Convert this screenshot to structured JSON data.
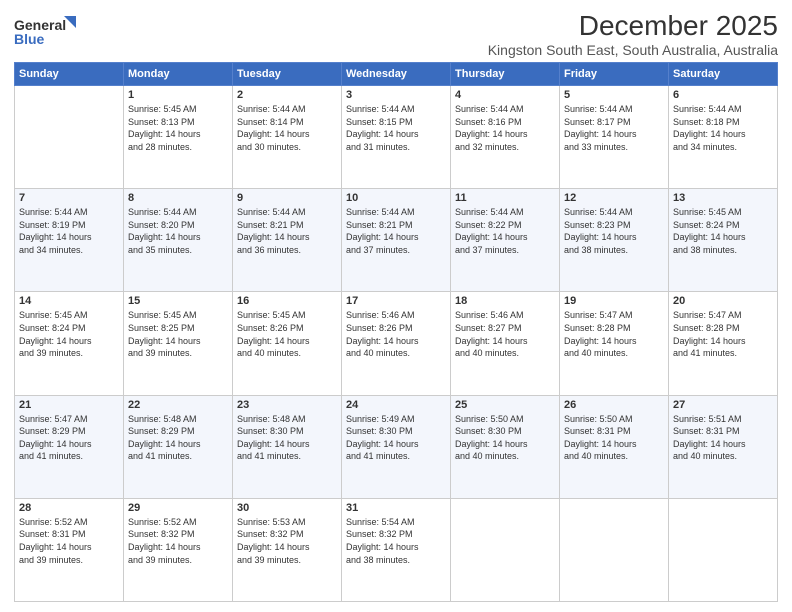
{
  "header": {
    "logo_line1": "General",
    "logo_line2": "Blue",
    "month": "December 2025",
    "location": "Kingston South East, South Australia, Australia"
  },
  "weekdays": [
    "Sunday",
    "Monday",
    "Tuesday",
    "Wednesday",
    "Thursday",
    "Friday",
    "Saturday"
  ],
  "weeks": [
    [
      {
        "day": "",
        "info": ""
      },
      {
        "day": "1",
        "info": "Sunrise: 5:45 AM\nSunset: 8:13 PM\nDaylight: 14 hours\nand 28 minutes."
      },
      {
        "day": "2",
        "info": "Sunrise: 5:44 AM\nSunset: 8:14 PM\nDaylight: 14 hours\nand 30 minutes."
      },
      {
        "day": "3",
        "info": "Sunrise: 5:44 AM\nSunset: 8:15 PM\nDaylight: 14 hours\nand 31 minutes."
      },
      {
        "day": "4",
        "info": "Sunrise: 5:44 AM\nSunset: 8:16 PM\nDaylight: 14 hours\nand 32 minutes."
      },
      {
        "day": "5",
        "info": "Sunrise: 5:44 AM\nSunset: 8:17 PM\nDaylight: 14 hours\nand 33 minutes."
      },
      {
        "day": "6",
        "info": "Sunrise: 5:44 AM\nSunset: 8:18 PM\nDaylight: 14 hours\nand 34 minutes."
      }
    ],
    [
      {
        "day": "7",
        "info": "Sunrise: 5:44 AM\nSunset: 8:19 PM\nDaylight: 14 hours\nand 34 minutes."
      },
      {
        "day": "8",
        "info": "Sunrise: 5:44 AM\nSunset: 8:20 PM\nDaylight: 14 hours\nand 35 minutes."
      },
      {
        "day": "9",
        "info": "Sunrise: 5:44 AM\nSunset: 8:21 PM\nDaylight: 14 hours\nand 36 minutes."
      },
      {
        "day": "10",
        "info": "Sunrise: 5:44 AM\nSunset: 8:21 PM\nDaylight: 14 hours\nand 37 minutes."
      },
      {
        "day": "11",
        "info": "Sunrise: 5:44 AM\nSunset: 8:22 PM\nDaylight: 14 hours\nand 37 minutes."
      },
      {
        "day": "12",
        "info": "Sunrise: 5:44 AM\nSunset: 8:23 PM\nDaylight: 14 hours\nand 38 minutes."
      },
      {
        "day": "13",
        "info": "Sunrise: 5:45 AM\nSunset: 8:24 PM\nDaylight: 14 hours\nand 38 minutes."
      }
    ],
    [
      {
        "day": "14",
        "info": "Sunrise: 5:45 AM\nSunset: 8:24 PM\nDaylight: 14 hours\nand 39 minutes."
      },
      {
        "day": "15",
        "info": "Sunrise: 5:45 AM\nSunset: 8:25 PM\nDaylight: 14 hours\nand 39 minutes."
      },
      {
        "day": "16",
        "info": "Sunrise: 5:45 AM\nSunset: 8:26 PM\nDaylight: 14 hours\nand 40 minutes."
      },
      {
        "day": "17",
        "info": "Sunrise: 5:46 AM\nSunset: 8:26 PM\nDaylight: 14 hours\nand 40 minutes."
      },
      {
        "day": "18",
        "info": "Sunrise: 5:46 AM\nSunset: 8:27 PM\nDaylight: 14 hours\nand 40 minutes."
      },
      {
        "day": "19",
        "info": "Sunrise: 5:47 AM\nSunset: 8:28 PM\nDaylight: 14 hours\nand 40 minutes."
      },
      {
        "day": "20",
        "info": "Sunrise: 5:47 AM\nSunset: 8:28 PM\nDaylight: 14 hours\nand 41 minutes."
      }
    ],
    [
      {
        "day": "21",
        "info": "Sunrise: 5:47 AM\nSunset: 8:29 PM\nDaylight: 14 hours\nand 41 minutes."
      },
      {
        "day": "22",
        "info": "Sunrise: 5:48 AM\nSunset: 8:29 PM\nDaylight: 14 hours\nand 41 minutes."
      },
      {
        "day": "23",
        "info": "Sunrise: 5:48 AM\nSunset: 8:30 PM\nDaylight: 14 hours\nand 41 minutes."
      },
      {
        "day": "24",
        "info": "Sunrise: 5:49 AM\nSunset: 8:30 PM\nDaylight: 14 hours\nand 41 minutes."
      },
      {
        "day": "25",
        "info": "Sunrise: 5:50 AM\nSunset: 8:30 PM\nDaylight: 14 hours\nand 40 minutes."
      },
      {
        "day": "26",
        "info": "Sunrise: 5:50 AM\nSunset: 8:31 PM\nDaylight: 14 hours\nand 40 minutes."
      },
      {
        "day": "27",
        "info": "Sunrise: 5:51 AM\nSunset: 8:31 PM\nDaylight: 14 hours\nand 40 minutes."
      }
    ],
    [
      {
        "day": "28",
        "info": "Sunrise: 5:52 AM\nSunset: 8:31 PM\nDaylight: 14 hours\nand 39 minutes."
      },
      {
        "day": "29",
        "info": "Sunrise: 5:52 AM\nSunset: 8:32 PM\nDaylight: 14 hours\nand 39 minutes."
      },
      {
        "day": "30",
        "info": "Sunrise: 5:53 AM\nSunset: 8:32 PM\nDaylight: 14 hours\nand 39 minutes."
      },
      {
        "day": "31",
        "info": "Sunrise: 5:54 AM\nSunset: 8:32 PM\nDaylight: 14 hours\nand 38 minutes."
      },
      {
        "day": "",
        "info": ""
      },
      {
        "day": "",
        "info": ""
      },
      {
        "day": "",
        "info": ""
      }
    ]
  ]
}
